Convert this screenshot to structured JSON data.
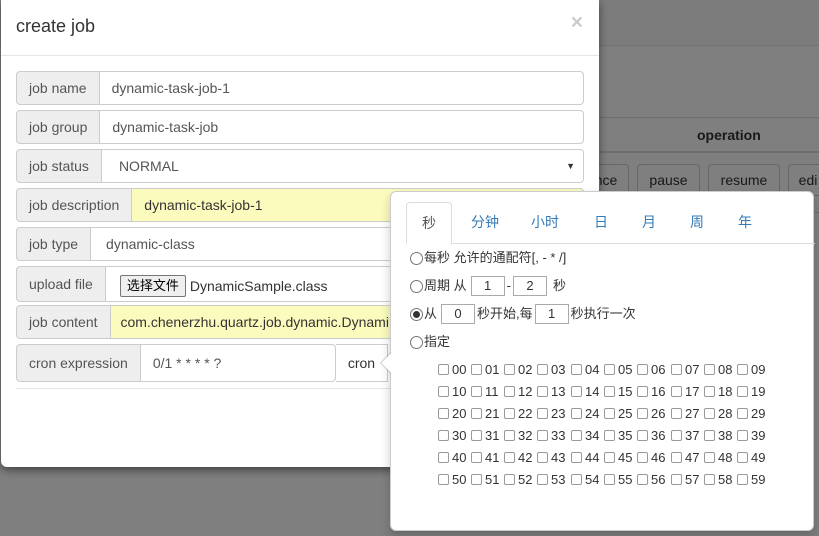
{
  "background": {
    "operation_header": "operation",
    "buttons": [
      "nce",
      "pause",
      "resume",
      "edi"
    ]
  },
  "modal": {
    "title": "create job",
    "close": "×",
    "fields": {
      "job_name": {
        "label": "job name",
        "value": "dynamic-task-job-1"
      },
      "job_group": {
        "label": "job group",
        "value": "dynamic-task-job"
      },
      "job_status": {
        "label": "job status",
        "value": "NORMAL"
      },
      "job_description": {
        "label": "job description",
        "value": "dynamic-task-job-1"
      },
      "job_type": {
        "label": "job type",
        "value": "dynamic-class"
      },
      "upload_file": {
        "label": "upload file",
        "button": "选择文件",
        "filename": "DynamicSample.class"
      },
      "job_content": {
        "label": "job content",
        "value": "com.chenerzhu.quartz.job.dynamic.Dynami"
      },
      "cron_expression": {
        "label": "cron expression",
        "value": "0/1 * * * * ?",
        "button": "cron"
      }
    }
  },
  "cron_popover": {
    "tabs": [
      "秒",
      "分钟",
      "小时",
      "日",
      "月",
      "周",
      "年"
    ],
    "active_tab": "秒",
    "options": {
      "every": {
        "label": "每秒 允许的通配符[, - * /]",
        "selected": false
      },
      "period": {
        "prefix": "周期 从",
        "from": "1",
        "dash": "-",
        "to": "2",
        "suffix": "秒",
        "selected": false
      },
      "start": {
        "prefix": "从",
        "start": "0",
        "middle": "秒开始,每",
        "every": "1",
        "suffix": "秒执行一次",
        "selected": true
      },
      "specify": {
        "label": "指定",
        "selected": false
      }
    },
    "seconds": [
      "00",
      "01",
      "02",
      "03",
      "04",
      "05",
      "06",
      "07",
      "08",
      "09",
      "10",
      "11",
      "12",
      "13",
      "14",
      "15",
      "16",
      "17",
      "18",
      "19",
      "20",
      "21",
      "22",
      "23",
      "24",
      "25",
      "26",
      "27",
      "28",
      "29",
      "30",
      "31",
      "32",
      "33",
      "34",
      "35",
      "36",
      "37",
      "38",
      "39",
      "40",
      "41",
      "42",
      "43",
      "44",
      "45",
      "46",
      "47",
      "48",
      "49",
      "50",
      "51",
      "52",
      "53",
      "54",
      "55",
      "56",
      "57",
      "58",
      "59"
    ]
  }
}
